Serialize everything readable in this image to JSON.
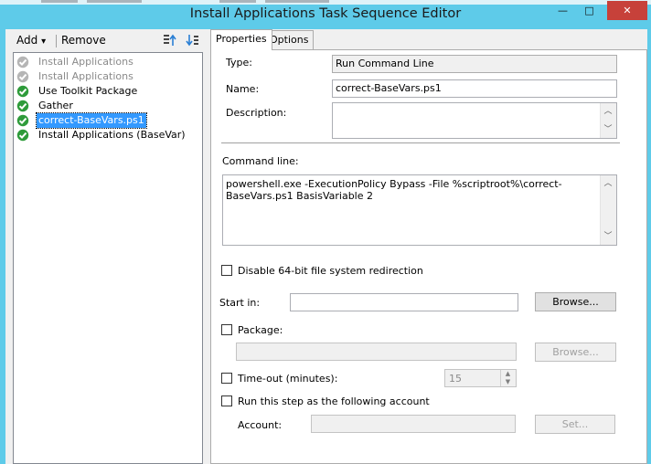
{
  "window": {
    "title": "Install Applications Task Sequence Editor",
    "controls": {
      "minimize": "—",
      "maximize": "□",
      "close": "✕"
    }
  },
  "toolbar": {
    "add_label": "Add",
    "add_arrow": "▾",
    "remove_label": "Remove"
  },
  "tree": {
    "items": [
      {
        "label": "Install Applications",
        "state": "disabled"
      },
      {
        "label": "Install Applications",
        "state": "disabled"
      },
      {
        "label": "Use Toolkit Package",
        "state": "ok"
      },
      {
        "label": "Gather",
        "state": "ok"
      },
      {
        "label": "correct-BaseVars.ps1",
        "state": "selected"
      },
      {
        "label": "Install Applications (BaseVar)",
        "state": "ok"
      }
    ]
  },
  "tabs": [
    {
      "label": "Properties",
      "active": true
    },
    {
      "label": "Options",
      "active": false
    }
  ],
  "properties": {
    "type_label": "Type:",
    "type_value": "Run Command Line",
    "name_label": "Name:",
    "name_value": "correct-BaseVars.ps1",
    "description_label": "Description:",
    "description_value": "",
    "command_line_label": "Command line:",
    "command_line_value": "powershell.exe -ExecutionPolicy Bypass -File %scriptroot%\\correct-BaseVars.ps1 BasisVariable 2",
    "disable_redirection_label": "Disable 64-bit file system redirection",
    "start_in_label": "Start in:",
    "start_in_value": "",
    "browse_label": "Browse...",
    "package_label": "Package:",
    "package_value": "",
    "package_browse_label": "Browse...",
    "timeout_label": "Time-out (minutes):",
    "timeout_value": "15",
    "run_as_label": "Run this step as the following account",
    "account_label": "Account:",
    "account_value": "",
    "set_label": "Set..."
  },
  "colors": {
    "titlebar": "#5ecbe9",
    "selection": "#3399ff",
    "check_green": "#2e9b3a",
    "close_red": "#c7413a"
  },
  "icons": {
    "ok": "green-check-icon",
    "disabled": "grey-check-icon"
  }
}
